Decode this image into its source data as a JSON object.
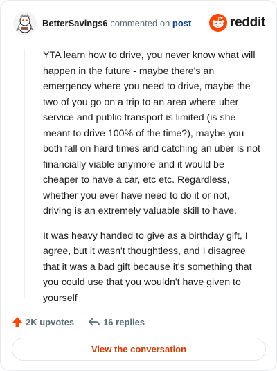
{
  "header": {
    "username": "BetterSavings6",
    "action_text": "commented on",
    "post_link": "post",
    "brand": "reddit",
    "icons": {
      "avatar": "snoo-avatar-icon",
      "logo": "reddit-logo-icon"
    }
  },
  "comment": {
    "paragraphs": [
      "YTA learn how to drive, you never know what will happen in the future - maybe there's an emergency where you need to drive, maybe the two of you go on a trip to an area where uber service and public transport is limited (is she meant to drive 100% of the time?), maybe you both fall on hard times and catching an uber is not financially viable anymore and it would be cheaper to have a car, etc etc. Regardless, whether you ever have need to do it or not, driving is an extremely valuable skill to have.",
      "It was heavy handed to give as a birthday gift, I agree, but it wasn't thoughtless, and I disagree that it was a bad gift because it's something that you could use that you wouldn't have given to yourself"
    ]
  },
  "stats": {
    "upvotes": "2K upvotes",
    "replies": "16 replies",
    "icons": {
      "upvote": "upvote-arrow-icon",
      "replies": "reply-arrow-icon"
    }
  },
  "cta": {
    "label": "View the conversation"
  },
  "colors": {
    "accent": "#d93a00",
    "upvote": "#ff4500",
    "link": "#0a449b",
    "muted": "#576f76"
  }
}
